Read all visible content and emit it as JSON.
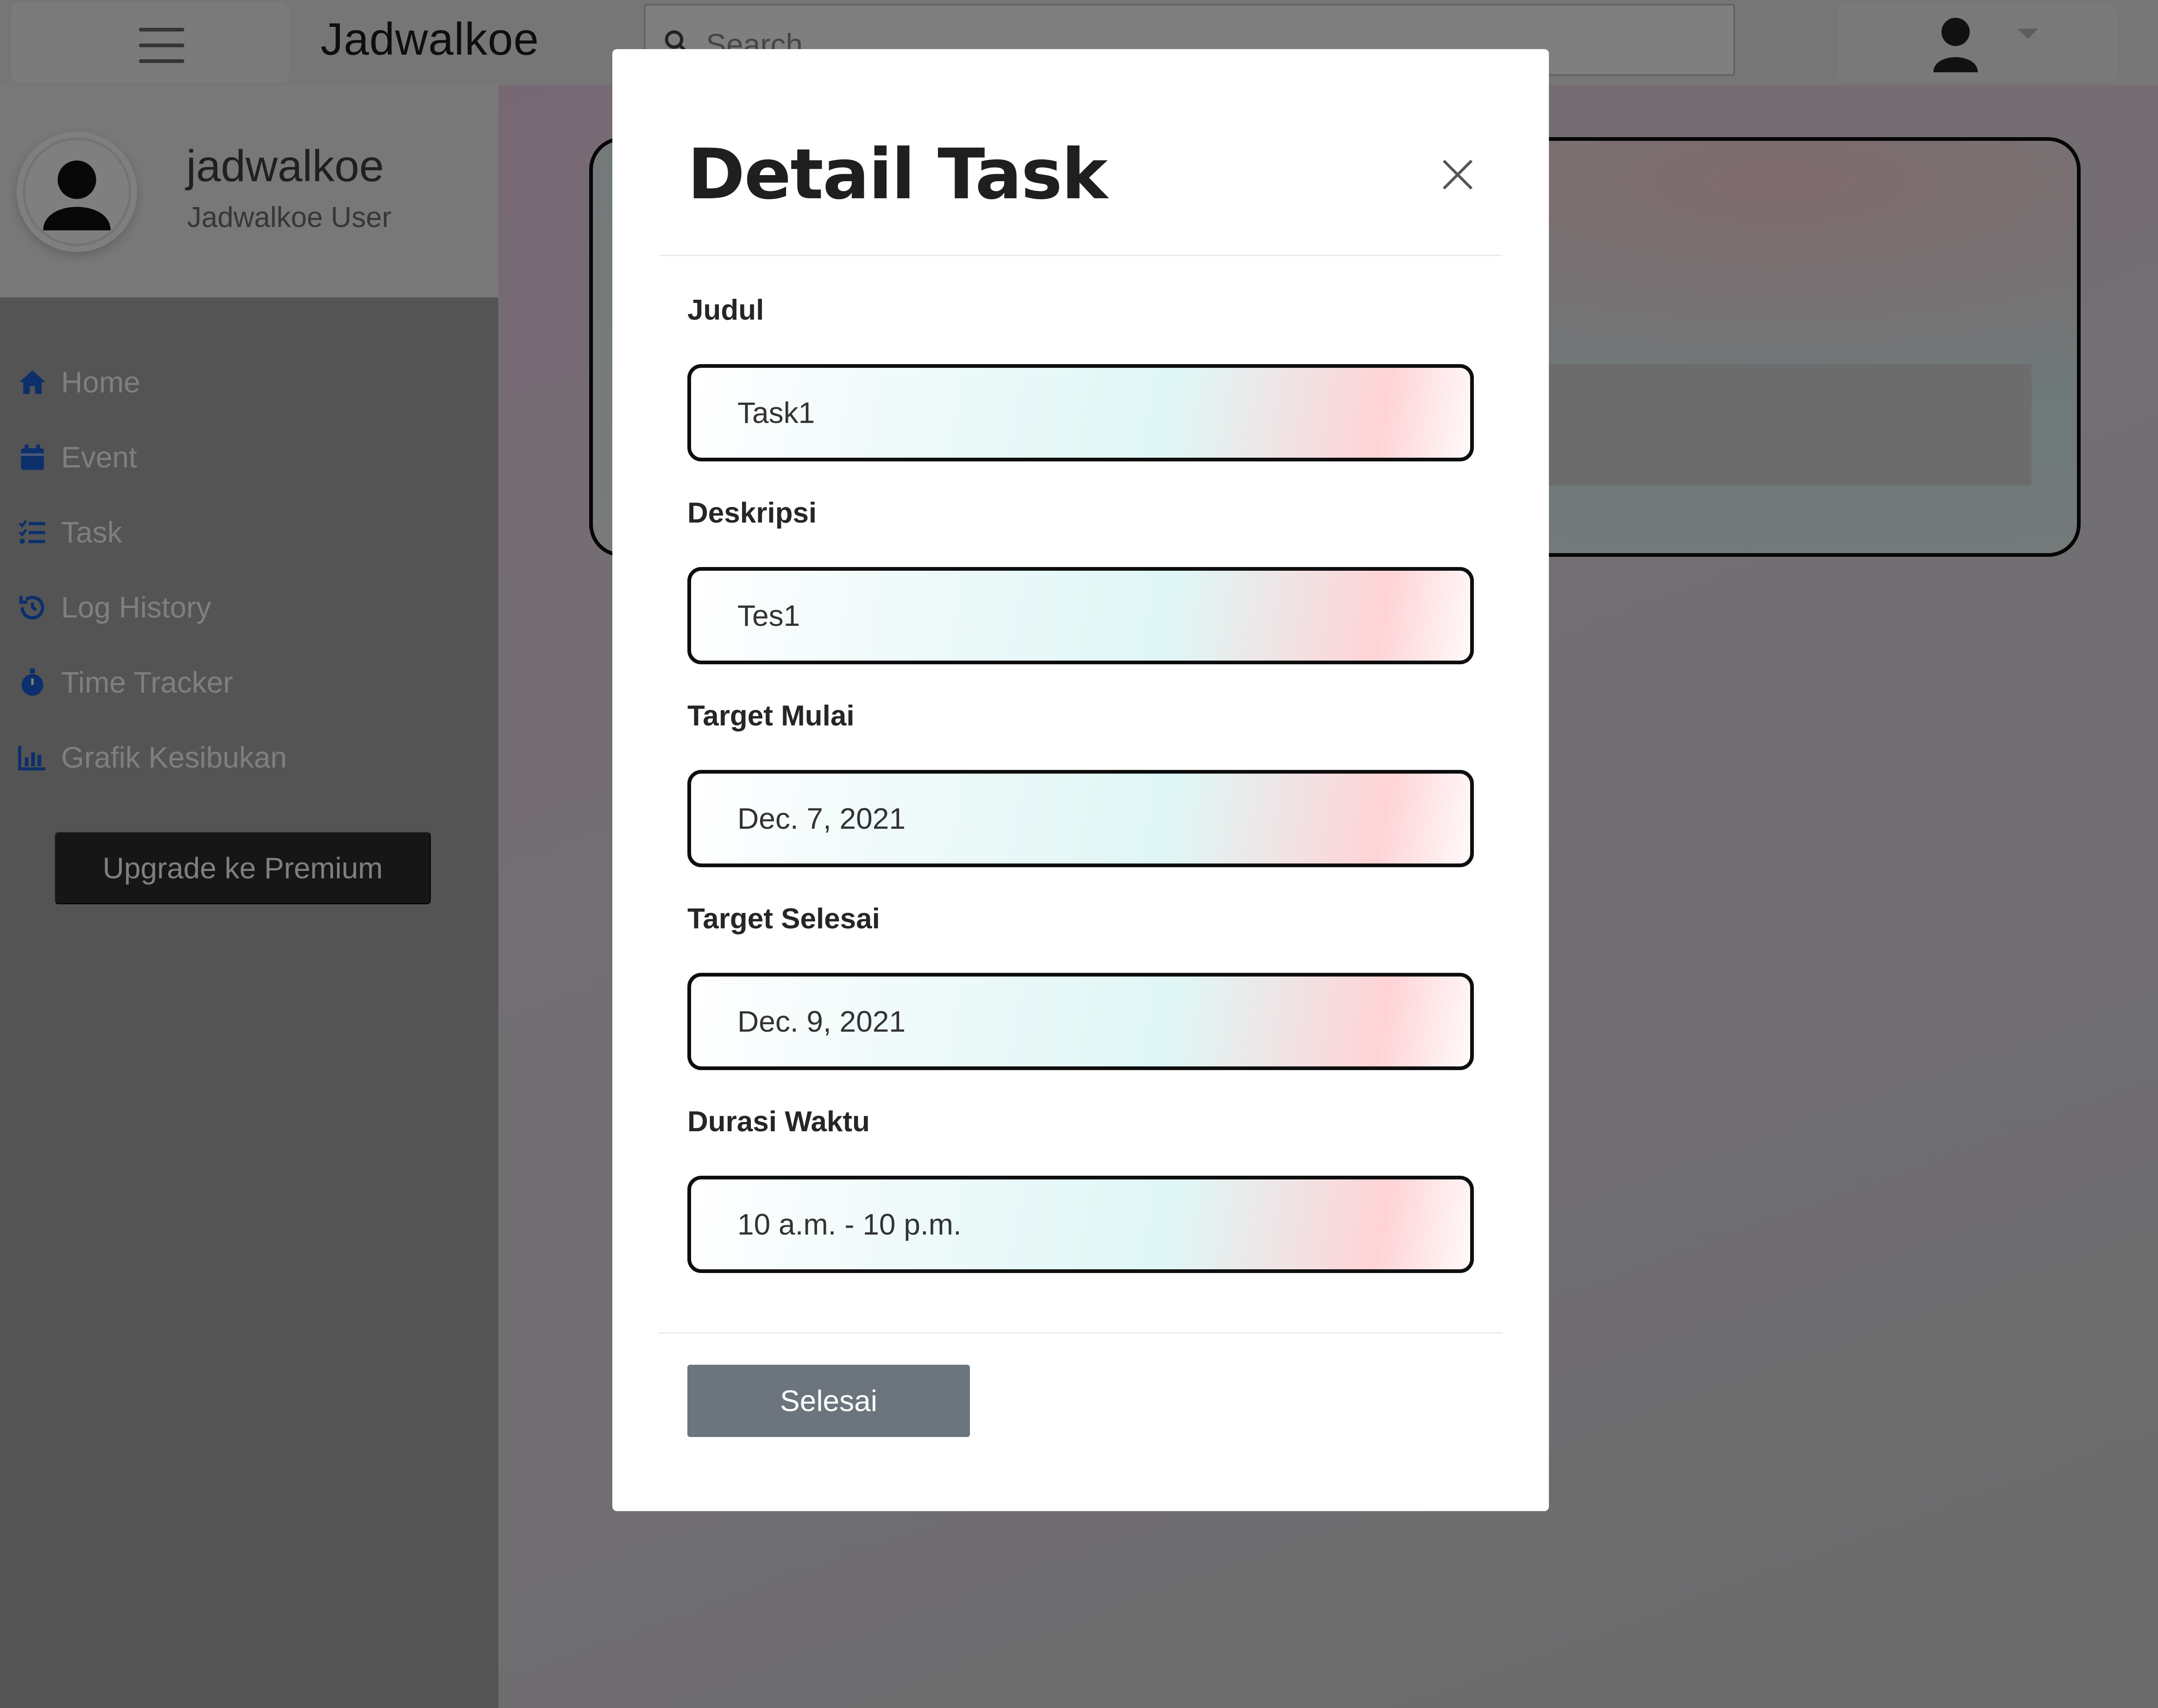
{
  "app": {
    "brand": "Jadwalkoe",
    "search_placeholder": "Search..."
  },
  "profile": {
    "name": "jadwalkoe",
    "role": "Jadwalkoe User"
  },
  "sidebar": {
    "items": [
      {
        "label": "Home",
        "icon": "home-icon"
      },
      {
        "label": "Event",
        "icon": "calendar-icon"
      },
      {
        "label": "Task",
        "icon": "task-list-icon"
      },
      {
        "label": "Log History",
        "icon": "history-icon"
      },
      {
        "label": "Time Tracker",
        "icon": "stopwatch-icon"
      },
      {
        "label": "Grafik Kesibukan",
        "icon": "bar-chart-icon"
      }
    ],
    "premium_label": "Upgrade ke Premium"
  },
  "modal": {
    "title": "Detail Task",
    "fields": [
      {
        "label": "Judul",
        "value": "Task1"
      },
      {
        "label": "Deskripsi",
        "value": "Tes1"
      },
      {
        "label": "Target Mulai",
        "value": "Dec. 7, 2021"
      },
      {
        "label": "Target Selesai",
        "value": "Dec. 9, 2021"
      },
      {
        "label": "Durasi Waktu",
        "value": "10 a.m. - 10 p.m."
      }
    ],
    "submit_label": "Selesai"
  },
  "colors": {
    "nav_icon": "#1a5fd6",
    "button_secondary": "#6c757d",
    "premium_button": "#2d2d2d"
  }
}
